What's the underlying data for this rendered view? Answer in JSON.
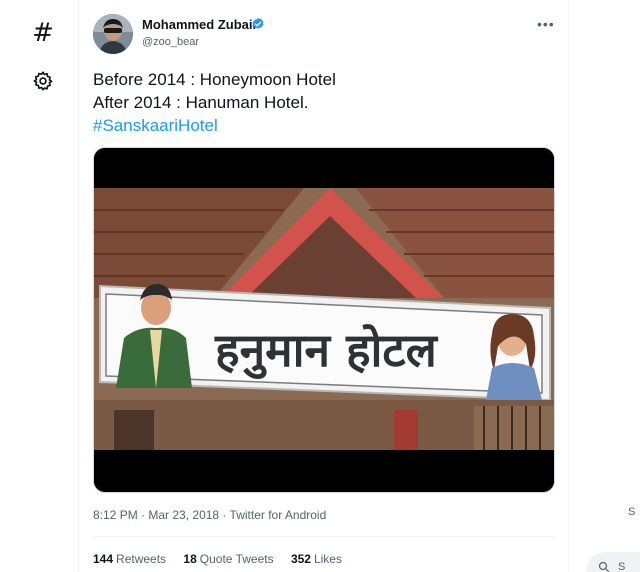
{
  "nav": {
    "explore_icon": "hash-icon",
    "settings_icon": "gear-icon"
  },
  "tweet": {
    "author": {
      "name": "Mohammed Zubair",
      "handle": "@zoo_bear",
      "verified": true
    },
    "more_label": "•••",
    "text_line1": "Before 2014 : Honeymoon Hotel",
    "text_line2": "After 2014 : Hanuman Hotel.",
    "hashtag": "#SanskaariHotel",
    "media": {
      "sign_text": "हनुमान होटल"
    },
    "time": "8:12 PM",
    "separator1": " · ",
    "date": "Mar 23, 2018",
    "separator2": " · ",
    "source": "Twitter for Android",
    "stats": {
      "retweets_count": "144",
      "retweets_label": "Retweets",
      "quotes_count": "18",
      "quotes_label": "Quote Tweets",
      "likes_count": "352",
      "likes_label": "Likes"
    }
  },
  "side": {
    "search_peek_letter": "S",
    "search_peek_text": "S"
  },
  "colors": {
    "accent": "#1d9bf0",
    "text_primary": "#0f1419",
    "text_secondary": "#536471",
    "border": "#eff3f4"
  }
}
